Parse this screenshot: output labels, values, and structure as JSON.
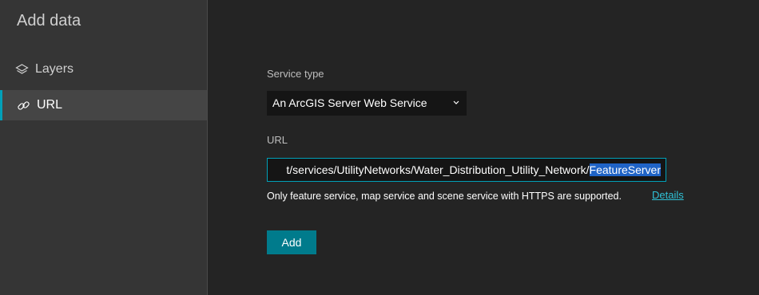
{
  "sidebar": {
    "title": "Add data",
    "items": [
      {
        "label": "Layers",
        "icon": "layers-icon"
      },
      {
        "label": "URL",
        "icon": "link-icon",
        "selected": true
      }
    ]
  },
  "form": {
    "service_type_label": "Service type",
    "service_type_value": "An ArcGIS Server Web Service",
    "url_label": "URL",
    "url_value_visible": "t/services/UtilityNetworks/Water_Distribution_Utility_Network/",
    "url_value_selected": "FeatureServer",
    "hint": "Only feature service, map service and scene service with HTTPS are supported.",
    "details_link": "Details",
    "add_label": "Add"
  },
  "colors": {
    "accent": "#00a0b8",
    "button": "#007b8c",
    "link": "#2fc1d6",
    "selection": "#1f63c6"
  }
}
